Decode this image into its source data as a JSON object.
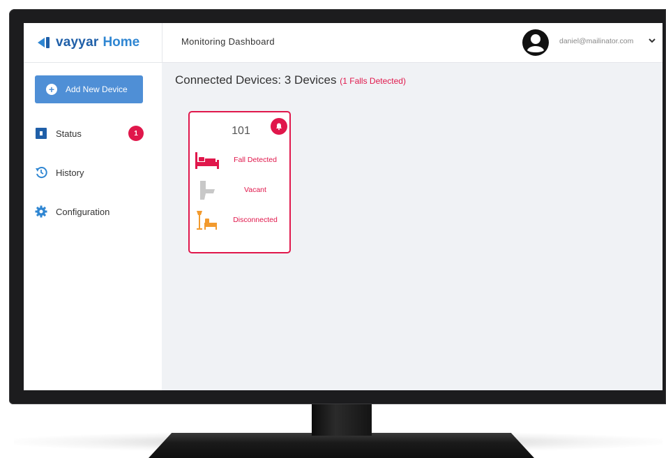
{
  "app": {
    "brand": "vayyar",
    "brand_suffix": "Home",
    "page_title": "Monitoring Dashboard",
    "user_email": "daniel@mailinator.com"
  },
  "sidebar": {
    "add_button_label": "Add New Device",
    "items": [
      {
        "label": "Status",
        "icon": "status-square-icon",
        "badge": "1"
      },
      {
        "label": "History",
        "icon": "history-icon"
      },
      {
        "label": "Configuration",
        "icon": "gear-icon"
      }
    ]
  },
  "main": {
    "heading": "Connected Devices: 3 Devices",
    "falls_note": "(1 Falls Detected)",
    "devices": [
      {
        "name": "101",
        "alert_icon": "bell-icon",
        "rows": [
          {
            "icon": "bed-icon",
            "status": "Fall Detected",
            "color": "#e0174b"
          },
          {
            "icon": "toilet-icon",
            "status": "Vacant",
            "color": "#e0174b"
          },
          {
            "icon": "lamp-sofa-icon",
            "status": "Disconnected",
            "color": "#e0174b"
          }
        ]
      }
    ]
  },
  "colors": {
    "accent": "#4f8fd6",
    "alert": "#e0174b",
    "brand": "#1f5fa8",
    "disconnected_icon": "#f29a2e",
    "vacant_icon": "#c8c8c8"
  }
}
